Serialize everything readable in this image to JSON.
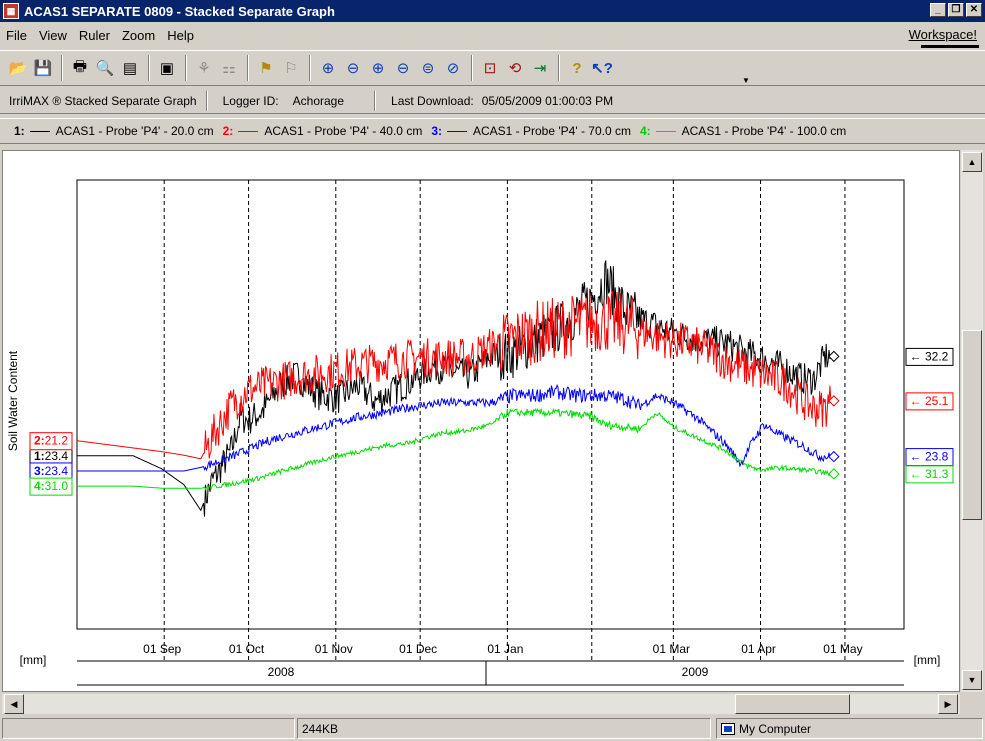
{
  "window": {
    "title": "ACAS1 SEPARATE 0809 - Stacked Separate Graph",
    "app_icon": "irrimax-app-icon",
    "controls": [
      "minimize",
      "maximize",
      "close"
    ]
  },
  "menu": {
    "items": [
      "File",
      "View",
      "Ruler",
      "Zoom",
      "Help"
    ],
    "workspace": "Workspace!"
  },
  "toolbar": {
    "buttons": [
      "open",
      "save",
      "print",
      "print-preview",
      "page-setup",
      "export",
      "tree",
      "properties",
      "tag",
      "tag-grey",
      "zoom-in-x",
      "zoom-out-x",
      "zoom-in-y",
      "zoom-out-y",
      "zoom-fit",
      "zoom-reset",
      "zoom-window",
      "ruler",
      "go-to-end",
      "help",
      "context-help"
    ]
  },
  "infobar": {
    "graph_type": "IrriMAX ® Stacked Separate Graph",
    "logger_label": "Logger ID:",
    "logger_value": "Achorage",
    "download_label": "Last Download:",
    "download_value": "05/05/2009 01:00:03 PM"
  },
  "legend": [
    {
      "num": "1:",
      "label": "ACAS1 - Probe 'P4' - 20.0 cm",
      "color": "#000000"
    },
    {
      "num": "2:",
      "label": "ACAS1 - Probe 'P4' - 40.0 cm",
      "color": "#ff0000"
    },
    {
      "num": "3:",
      "label": "ACAS1 - Probe 'P4' - 70.0 cm",
      "color": "#0000ff"
    },
    {
      "num": "4:",
      "label": "ACAS1 - Probe 'P4' - 100.0 cm",
      "color": "#00dd00"
    }
  ],
  "chart_data": {
    "type": "line",
    "ylabel": "Soil Water Content",
    "unit_label": "[mm]",
    "x_tick_labels": [
      "01 Sep",
      "01 Oct",
      "01 Nov",
      "01 Dec",
      "01 Jan",
      "01 Mar",
      "01 Apr",
      "01 May"
    ],
    "x_ticks_days": [
      31,
      61,
      92,
      122,
      153,
      212,
      243,
      273
    ],
    "year_labels": [
      "2008",
      "2009"
    ],
    "x_range_days": [
      0,
      294
    ],
    "series": [
      {
        "name": "ACAS1 - Probe 'P4' - 20.0 cm",
        "num": "1",
        "color": "#000000",
        "start_value": "23.4",
        "end_value": "32.2",
        "end_marker": "diamond",
        "points": [
          [
            0,
            23.4
          ],
          [
            10,
            23.4
          ],
          [
            20,
            23.4
          ],
          [
            30,
            23.0
          ],
          [
            38,
            22.5
          ],
          [
            44,
            21.7
          ],
          [
            48,
            22.6
          ],
          [
            51,
            23.0
          ],
          [
            55,
            23.6
          ],
          [
            58,
            24.6
          ],
          [
            61,
            24.5
          ],
          [
            66,
            24.8
          ],
          [
            72,
            25.6
          ],
          [
            78,
            25.9
          ],
          [
            86,
            25.3
          ],
          [
            93,
            25.2
          ],
          [
            100,
            25.6
          ],
          [
            106,
            25.1
          ],
          [
            112,
            25.4
          ],
          [
            120,
            25.8
          ],
          [
            127,
            26.2
          ],
          [
            134,
            26.0
          ],
          [
            140,
            25.9
          ],
          [
            147,
            26.5
          ],
          [
            155,
            26.6
          ],
          [
            163,
            27.0
          ],
          [
            170,
            27.3
          ],
          [
            177,
            27.8
          ],
          [
            183,
            28.3
          ],
          [
            188,
            28.9
          ],
          [
            195,
            27.9
          ],
          [
            202,
            27.6
          ],
          [
            210,
            27.3
          ],
          [
            217,
            27.1
          ],
          [
            224,
            27.0
          ],
          [
            231,
            26.9
          ],
          [
            238,
            26.6
          ],
          [
            245,
            26.4
          ],
          [
            252,
            26.1
          ],
          [
            258,
            25.8
          ],
          [
            262,
            25.8
          ],
          [
            266,
            26.5
          ],
          [
            268,
            26.5
          ]
        ]
      },
      {
        "name": "ACAS1 - Probe 'P4' - 40.0 cm",
        "num": "2",
        "color": "#ff0000",
        "start_value": "21.2",
        "end_value": "25.1",
        "end_marker": "diamond",
        "points": [
          [
            0,
            21.2
          ],
          [
            10,
            21.1
          ],
          [
            20,
            21.0
          ],
          [
            30,
            20.9
          ],
          [
            38,
            20.8
          ],
          [
            44,
            20.7
          ],
          [
            48,
            21.3
          ],
          [
            55,
            22.2
          ],
          [
            61,
            22.6
          ],
          [
            70,
            22.8
          ],
          [
            80,
            23.0
          ],
          [
            90,
            23.1
          ],
          [
            100,
            23.3
          ],
          [
            110,
            23.4
          ],
          [
            120,
            23.5
          ],
          [
            130,
            23.5
          ],
          [
            140,
            23.5
          ],
          [
            147,
            23.8
          ],
          [
            155,
            24.0
          ],
          [
            163,
            24.2
          ],
          [
            170,
            24.3
          ],
          [
            177,
            24.4
          ],
          [
            183,
            24.5
          ],
          [
            188,
            24.5
          ],
          [
            195,
            24.4
          ],
          [
            202,
            24.2
          ],
          [
            210,
            24.0
          ],
          [
            217,
            23.9
          ],
          [
            224,
            23.7
          ],
          [
            231,
            23.4
          ],
          [
            238,
            23.2
          ],
          [
            245,
            23.0
          ],
          [
            252,
            22.8
          ],
          [
            258,
            22.3
          ],
          [
            262,
            22.1
          ],
          [
            266,
            22.1
          ],
          [
            268,
            22.3
          ]
        ]
      },
      {
        "name": "ACAS1 - Probe 'P4' - 70.0 cm",
        "num": "3",
        "color": "#0000ff",
        "start_value": "23.4",
        "end_value": "23.8",
        "end_marker": "diamond",
        "points": [
          [
            0,
            23.4
          ],
          [
            10,
            23.4
          ],
          [
            20,
            23.4
          ],
          [
            30,
            23.4
          ],
          [
            38,
            23.4
          ],
          [
            44,
            23.5
          ],
          [
            48,
            23.6
          ],
          [
            55,
            23.8
          ],
          [
            61,
            24.0
          ],
          [
            70,
            24.3
          ],
          [
            80,
            24.5
          ],
          [
            90,
            24.7
          ],
          [
            100,
            24.9
          ],
          [
            108,
            25.0
          ],
          [
            114,
            25.1
          ],
          [
            120,
            25.2
          ],
          [
            130,
            25.3
          ],
          [
            147,
            25.3
          ],
          [
            155,
            25.5
          ],
          [
            163,
            25.5
          ],
          [
            170,
            25.6
          ],
          [
            177,
            25.5
          ],
          [
            183,
            25.5
          ],
          [
            188,
            25.5
          ],
          [
            195,
            25.4
          ],
          [
            200,
            25.2
          ],
          [
            206,
            25.5
          ],
          [
            212,
            25.3
          ],
          [
            220,
            24.9
          ],
          [
            230,
            24.2
          ],
          [
            236,
            23.6
          ],
          [
            240,
            24.2
          ],
          [
            244,
            24.7
          ],
          [
            250,
            24.4
          ],
          [
            258,
            24.1
          ],
          [
            264,
            23.8
          ],
          [
            268,
            23.8
          ]
        ]
      },
      {
        "name": "ACAS1 - Probe 'P4' - 100.0 cm",
        "num": "4",
        "color": "#00dd00",
        "start_value": "31.0",
        "end_value": "31.3",
        "end_marker": "diamond",
        "points": [
          [
            0,
            31.0
          ],
          [
            10,
            31.0
          ],
          [
            20,
            31.0
          ],
          [
            30,
            30.95
          ],
          [
            38,
            30.95
          ],
          [
            44,
            30.95
          ],
          [
            50,
            31.0
          ],
          [
            58,
            31.1
          ],
          [
            65,
            31.2
          ],
          [
            72,
            31.35
          ],
          [
            80,
            31.5
          ],
          [
            90,
            31.7
          ],
          [
            100,
            31.85
          ],
          [
            110,
            32.0
          ],
          [
            118,
            32.05
          ],
          [
            124,
            32.2
          ],
          [
            130,
            32.3
          ],
          [
            138,
            32.35
          ],
          [
            147,
            32.5
          ],
          [
            153,
            32.8
          ],
          [
            160,
            32.8
          ],
          [
            170,
            32.8
          ],
          [
            178,
            32.75
          ],
          [
            183,
            32.7
          ],
          [
            188,
            32.5
          ],
          [
            195,
            32.45
          ],
          [
            200,
            32.4
          ],
          [
            206,
            32.8
          ],
          [
            212,
            32.45
          ],
          [
            220,
            32.2
          ],
          [
            230,
            31.9
          ],
          [
            238,
            31.5
          ],
          [
            243,
            31.4
          ],
          [
            250,
            31.45
          ],
          [
            258,
            31.4
          ],
          [
            264,
            31.35
          ],
          [
            268,
            31.3
          ]
        ]
      }
    ]
  },
  "status": {
    "memory": "244KB",
    "location": "My Computer"
  }
}
